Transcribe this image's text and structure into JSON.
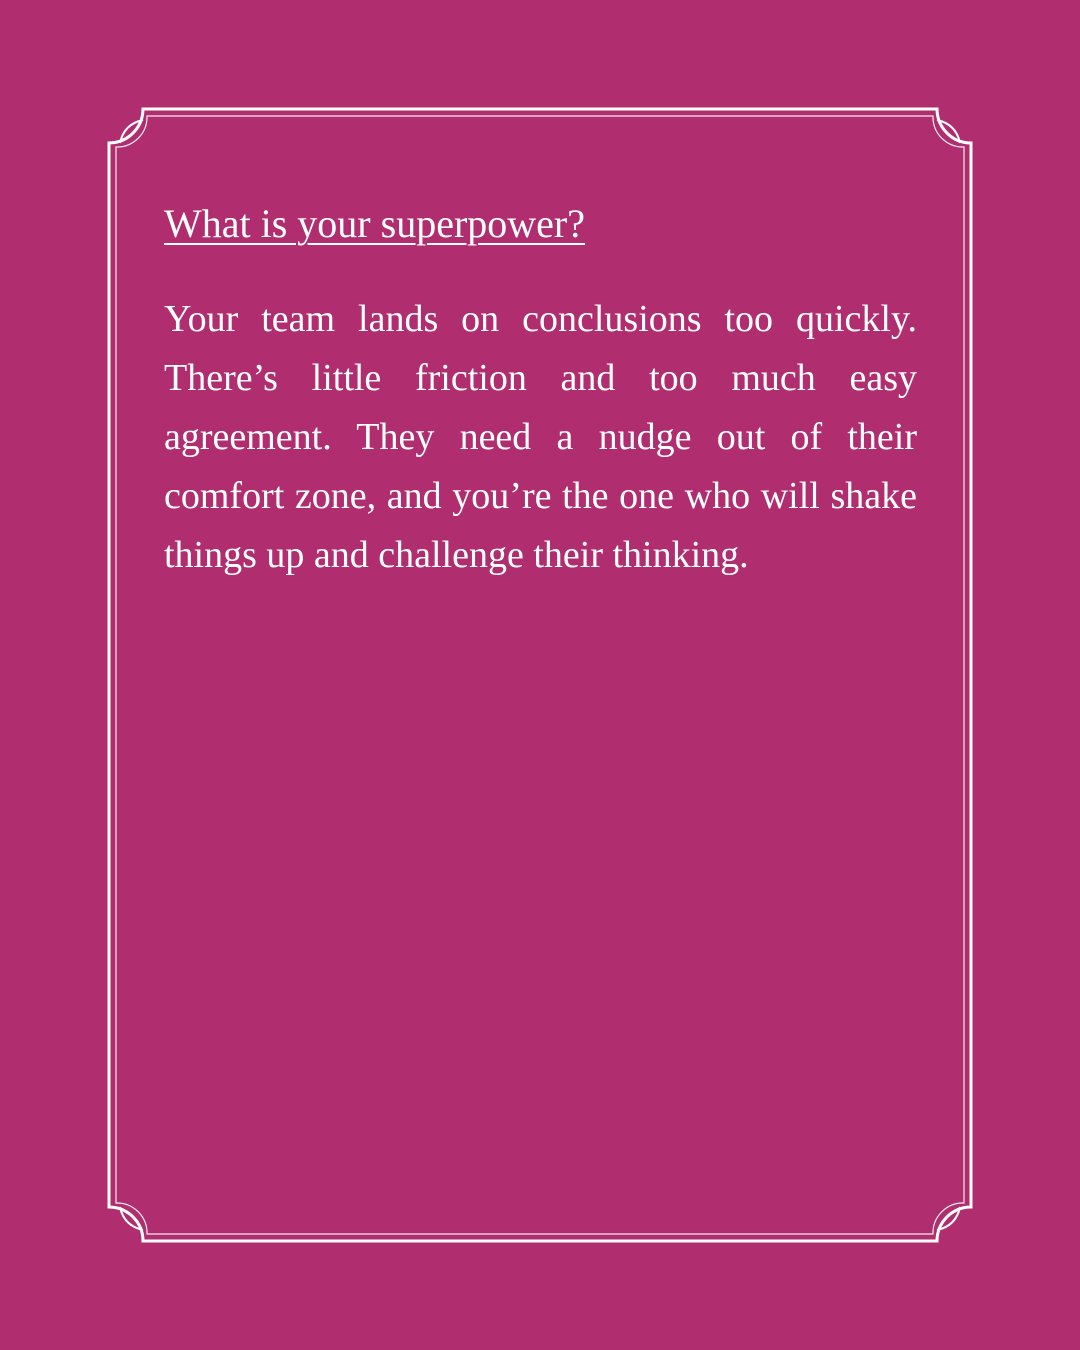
{
  "colors": {
    "background": "#b02e6f",
    "foreground": "#ffffff"
  },
  "card": {
    "heading": "What is your superpower?",
    "body": "Your team lands on conclusions too quickly. There’s little friction and too much easy agreement. They need a nudge out of their comfort zone, and you’re the one who will shake things up and challenge their thinking."
  }
}
